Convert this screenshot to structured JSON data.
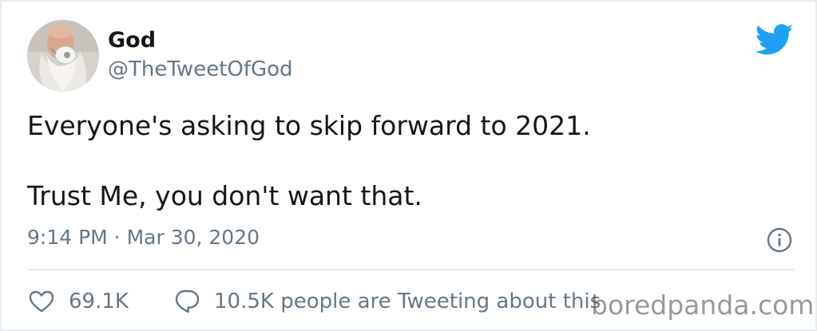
{
  "author": {
    "display_name": "God",
    "handle": "@TheTweetOfGod"
  },
  "tweet": {
    "line1": "Everyone's asking to skip forward to 2021.",
    "line2": "Trust Me, you don't want that.",
    "timestamp": "9:14 PM · Mar 30, 2020"
  },
  "actions": {
    "likes": "69.1K",
    "conversation": "10.5K people are Tweeting about this"
  },
  "watermark": "boredpanda.com",
  "icons": {
    "brand": "twitter-bird-icon",
    "info": "info-icon",
    "like": "heart-icon",
    "reply": "speech-bubble-icon"
  },
  "colors": {
    "twitter_blue": "#1da1f2",
    "secondary_text": "#657786",
    "primary_text": "#14171a"
  }
}
